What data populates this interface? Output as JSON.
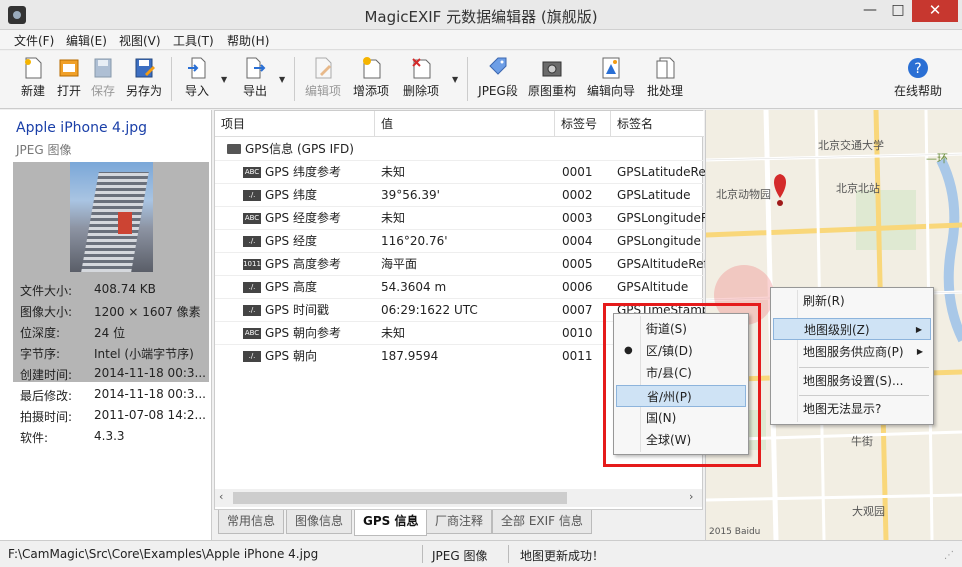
{
  "window": {
    "title": "MagicEXIF 元数据编辑器 (旗舰版)",
    "min": "—",
    "max": "□",
    "close": "✕"
  },
  "menu": [
    "文件(F)",
    "编辑(E)",
    "视图(V)",
    "工具(T)",
    "帮助(H)"
  ],
  "toolbar": {
    "new": "新建",
    "open": "打开",
    "save": "保存",
    "save_as": "另存为",
    "import": "导入",
    "export": "导出",
    "edit_item": "编辑项",
    "add_item": "增添项",
    "delete_item": "删除项",
    "jpeg_segment": "JPEG段",
    "rebuild": "原图重构",
    "wizard": "编辑向导",
    "batch": "批处理",
    "help": "在线帮助"
  },
  "file": {
    "name": "Apple iPhone 4.jpg",
    "type": "JPEG 图像",
    "props": [
      {
        "k": "文件大小:",
        "v": "408.74 KB"
      },
      {
        "k": "图像大小:",
        "v": "1200 × 1607 像素"
      },
      {
        "k": "位深度:",
        "v": "24 位"
      },
      {
        "k": "字节序:",
        "v": "Intel (小端字节序)"
      },
      {
        "k": "创建时间:",
        "v": "2014-11-18 00:3..."
      },
      {
        "k": "最后修改:",
        "v": "2014-11-18 00:3..."
      },
      {
        "k": "拍摄时间:",
        "v": "2011-07-08 14:2..."
      },
      {
        "k": "软件:",
        "v": "4.3.3"
      }
    ]
  },
  "table": {
    "headers": [
      "项目",
      "值",
      "标签号",
      "标签名"
    ],
    "group": "GPS信息 (GPS IFD)",
    "rows": [
      {
        "tag": "ABC",
        "item": "GPS 纬度参考",
        "value": "未知",
        "num": "0001",
        "name": "GPSLatitudeRef"
      },
      {
        "tag": "./.",
        "item": "GPS 纬度",
        "value": "39°56.39'",
        "num": "0002",
        "name": "GPSLatitude"
      },
      {
        "tag": "ABC",
        "item": "GPS 经度参考",
        "value": "未知",
        "num": "0003",
        "name": "GPSLongitudeRef"
      },
      {
        "tag": "./.",
        "item": "GPS 经度",
        "value": "116°20.76'",
        "num": "0004",
        "name": "GPSLongitude"
      },
      {
        "tag": "1011",
        "item": "GPS 高度参考",
        "value": "海平面",
        "num": "0005",
        "name": "GPSAltitudeRef"
      },
      {
        "tag": "./.",
        "item": "GPS 高度",
        "value": "54.3604 m",
        "num": "0006",
        "name": "GPSAltitude"
      },
      {
        "tag": "./.",
        "item": "GPS 时间戳",
        "value": "06:29:1622 UTC",
        "num": "0007",
        "name": "GPSTimeStamp"
      },
      {
        "tag": "ABC",
        "item": "GPS 朝向参考",
        "value": "未知",
        "num": "0010",
        "name": ""
      },
      {
        "tag": "./.",
        "item": "GPS 朝向",
        "value": "187.9594",
        "num": "0011",
        "name": ""
      }
    ]
  },
  "tabs": [
    "常用信息",
    "图像信息",
    "GPS 信息",
    "厂商注释",
    "全部 EXIF 信息"
  ],
  "active_tab": "GPS 信息",
  "map_labels": [
    "北京交通大学",
    "北京北站",
    "北京动物园",
    "—环",
    "牛街",
    "大观园",
    "2015 Baidu"
  ],
  "context_menu": {
    "items": [
      "刷新(R)",
      "地图级别(Z)",
      "地图服务供应商(P)",
      "地图服务设置(S)...",
      "地图无法显示?"
    ]
  },
  "submenu": {
    "items": [
      "街道(S)",
      "区/镇(D)",
      "市/县(C)",
      "省/州(P)",
      "国(N)",
      "全球(W)"
    ],
    "checked": "区/镇(D)",
    "highlighted": "省/州(P)"
  },
  "status": {
    "path": "F:\\CamMagic\\Src\\Core\\Examples\\Apple iPhone 4.jpg",
    "type": "JPEG 图像",
    "message": "地图更新成功！"
  }
}
